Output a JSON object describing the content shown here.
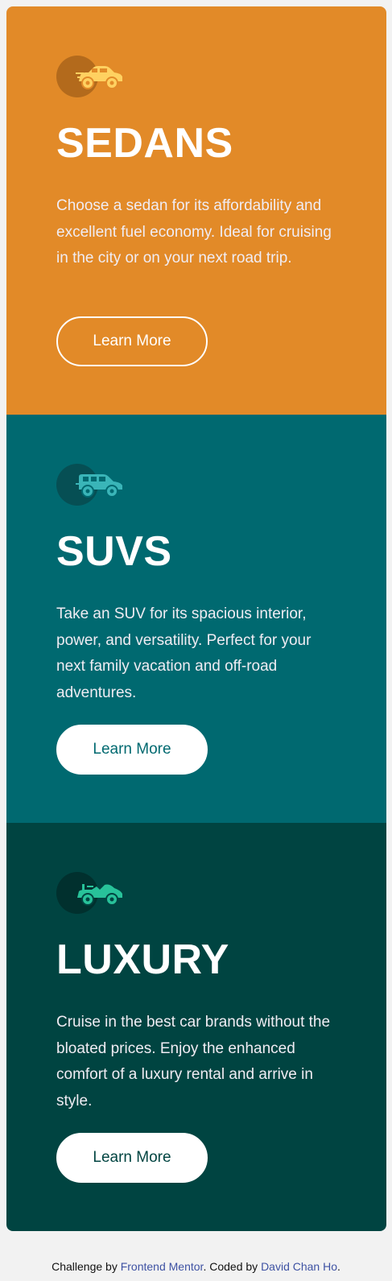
{
  "colors": {
    "page_background": "#f2f2f2",
    "sedans": "#e28a28",
    "suvs": "#006970",
    "luxury": "#004441",
    "button_text_light": "#ffffff",
    "link": "#3e52a3"
  },
  "cards": [
    {
      "key": "sedans",
      "icon": "sedan-car-icon",
      "title": "SEDANS",
      "text": "Choose a sedan for its affordability and excellent fuel economy. Ideal for cruising in the city or on your next road trip.",
      "button_label": "Learn More"
    },
    {
      "key": "suvs",
      "icon": "suv-car-icon",
      "title": "SUVS",
      "text": "Take an SUV for its spacious interior, power, and versatility. Perfect for your next family vacation and off-road adventures.",
      "button_label": "Learn More"
    },
    {
      "key": "luxury",
      "icon": "luxury-car-icon",
      "title": "LUXURY",
      "text": "Cruise in the best car brands without the bloated prices. Enjoy the enhanced comfort of a luxury rental and arrive in style.",
      "button_label": "Learn More"
    }
  ],
  "attribution": {
    "prefix": "Challenge by ",
    "link1": "Frontend Mentor",
    "middle": ". Coded by ",
    "link2": "David Chan Ho",
    "suffix": "."
  }
}
